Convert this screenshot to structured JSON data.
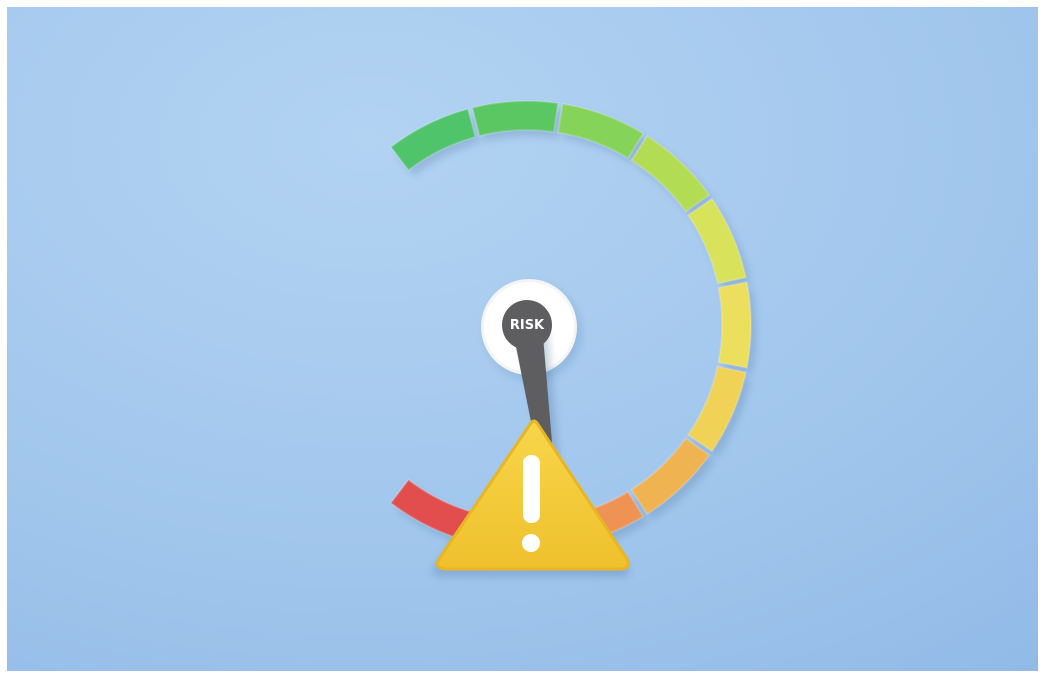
{
  "gauge": {
    "label": "RISK",
    "needle_level": 0.82,
    "segment_colors": [
      "#4fc46a",
      "#5bc763",
      "#86d35a",
      "#b3dc55",
      "#d8e25b",
      "#ecdf5e",
      "#f0d257",
      "#efb352",
      "#ee9353",
      "#ec6e55",
      "#e24d4d"
    ]
  },
  "warning_sign": {
    "symbol": "!",
    "color": "#f3cc3a"
  },
  "background_color": "#a3c7ec"
}
